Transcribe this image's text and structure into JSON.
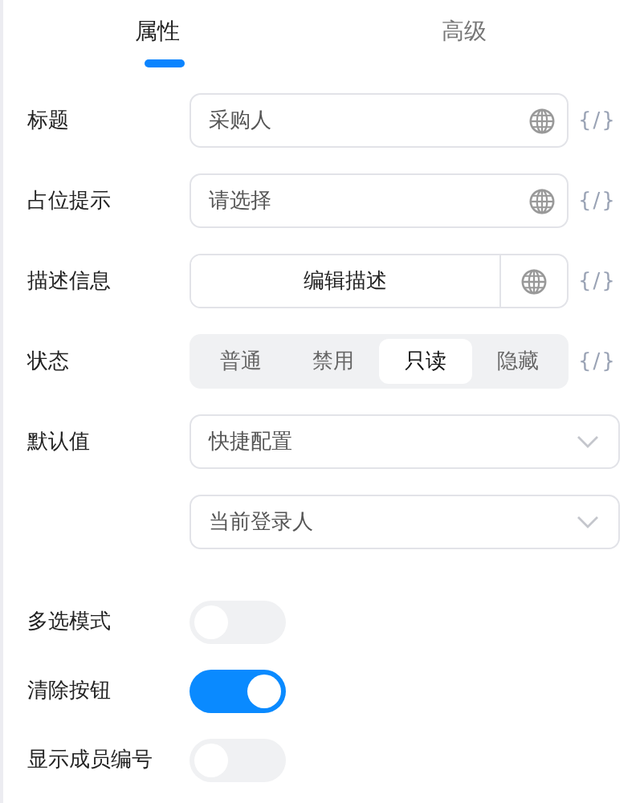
{
  "tabs": [
    {
      "label": "属性",
      "selected": true
    },
    {
      "label": "高级",
      "selected": false
    }
  ],
  "fields": [
    {
      "kind": "text",
      "label": "标题",
      "value": "采购人",
      "expr": "{/}"
    },
    {
      "kind": "text",
      "label": "占位提示",
      "value": "请选择",
      "expr": "{/}"
    },
    {
      "kind": "button",
      "label": "描述信息",
      "value": "编辑描述",
      "expr": "{/}"
    },
    {
      "kind": "segmented",
      "label": "状态",
      "options": [
        {
          "label": "普通",
          "selected": false
        },
        {
          "label": "禁用",
          "selected": false
        },
        {
          "label": "只读",
          "selected": true
        },
        {
          "label": "隐藏",
          "selected": false
        }
      ],
      "expr": "{/}"
    },
    {
      "kind": "select",
      "label": "默认值",
      "value": "快捷配置"
    },
    {
      "kind": "select",
      "value": "当前登录人"
    }
  ],
  "switches": [
    {
      "label": "多选模式",
      "on": false
    },
    {
      "label": "清除按钮",
      "on": true
    },
    {
      "label": "显示成员编号",
      "on": false
    }
  ]
}
